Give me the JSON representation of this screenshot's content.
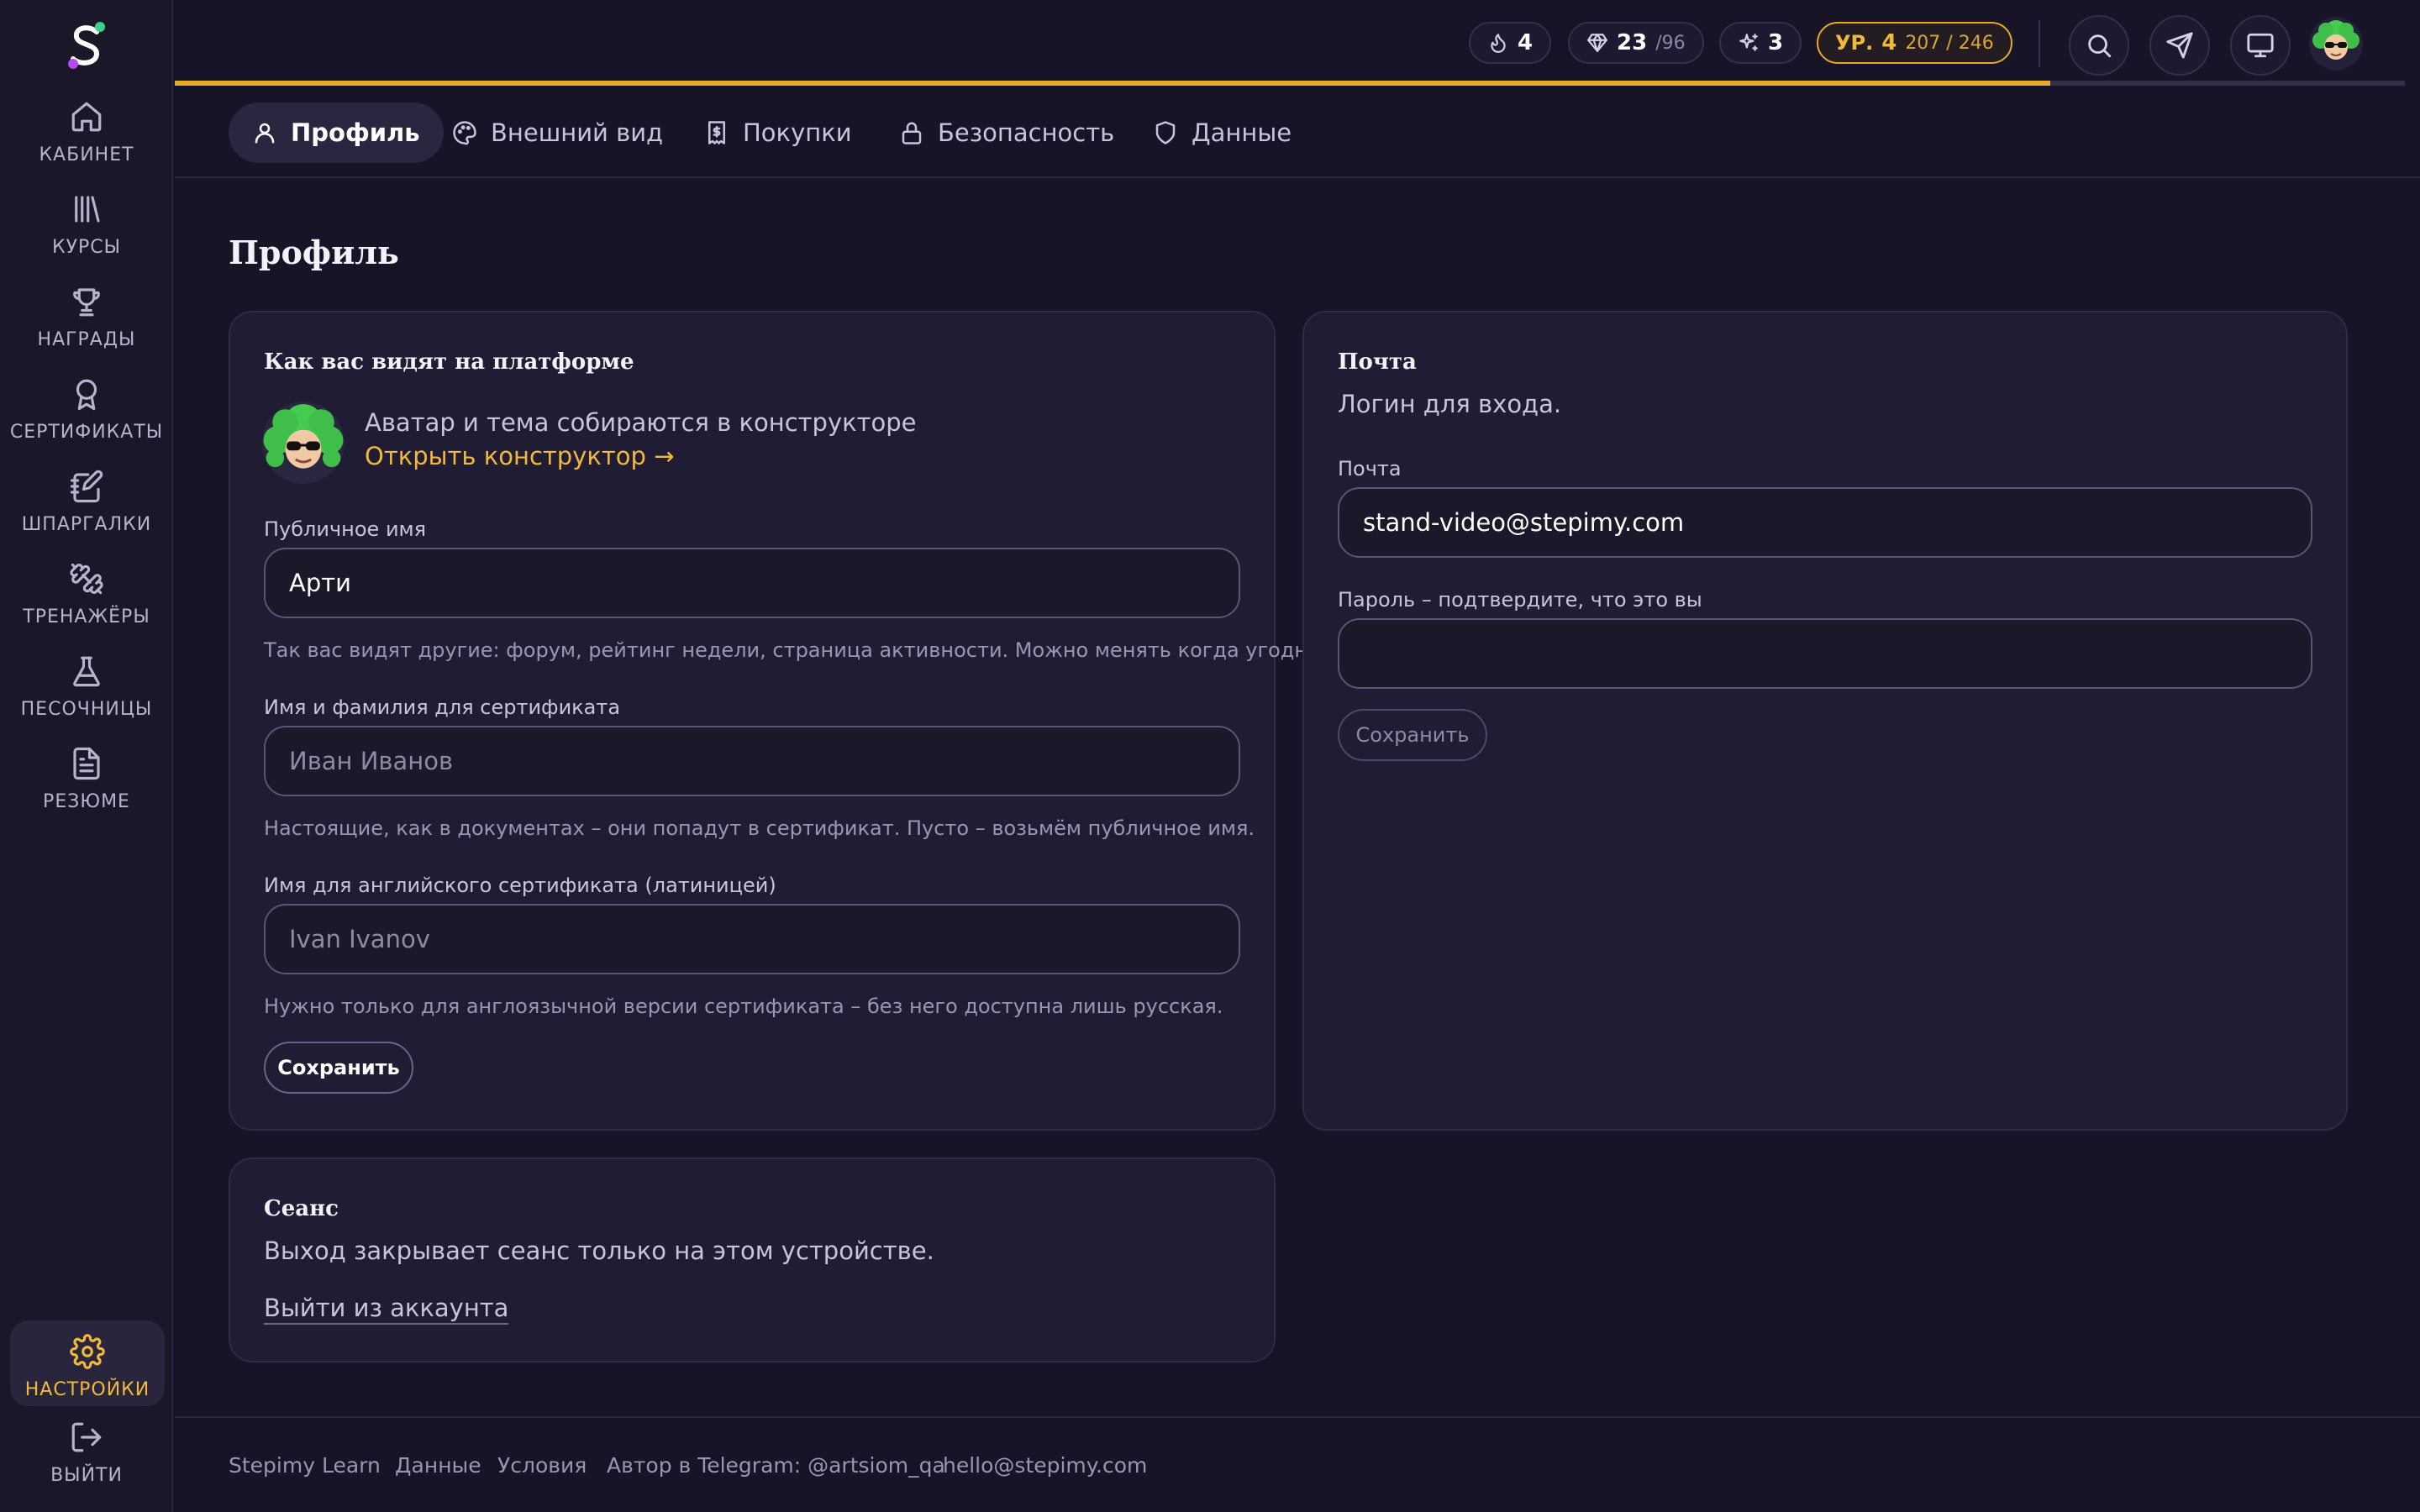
{
  "sidebar": {
    "items": [
      {
        "label": "КАБИНЕТ",
        "icon": "home-icon"
      },
      {
        "label": "КУРСЫ",
        "icon": "library-icon"
      },
      {
        "label": "НАГРАДЫ",
        "icon": "trophy-icon"
      },
      {
        "label": "СЕРТИФИКАТЫ",
        "icon": "award-icon"
      },
      {
        "label": "ШПАРГАЛКИ",
        "icon": "notebook-pen-icon"
      },
      {
        "label": "ТРЕНАЖЁРЫ",
        "icon": "dumbbell-icon"
      },
      {
        "label": "ПЕСОЧНИЦЫ",
        "icon": "flask-icon"
      },
      {
        "label": "РЕЗЮМЕ",
        "icon": "file-text-icon"
      }
    ],
    "settings_label": "НАСТРОЙКИ",
    "logout_label": "ВЫЙТИ"
  },
  "header": {
    "streak": "4",
    "gems": "23",
    "gems_total": "/96",
    "sparkles": "3",
    "level_prefix": "УР.",
    "level": "4",
    "xp": "207 / 246",
    "xp_progress": 0.8411
  },
  "tabs": [
    {
      "label": "Профиль",
      "icon": "user-icon",
      "active": true
    },
    {
      "label": "Внешний вид",
      "icon": "palette-icon"
    },
    {
      "label": "Покупки",
      "icon": "receipt-icon"
    },
    {
      "label": "Безопасность",
      "icon": "lock-icon"
    },
    {
      "label": "Данные",
      "icon": "shield-icon"
    }
  ],
  "page_title": "Профиль",
  "profile_card": {
    "title": "Как вас видят на платформе",
    "avatar_text": "Аватар и тема собираются в конструкторе",
    "constructor_link": "Открыть конструктор →",
    "public_name_label": "Публичное имя",
    "public_name_value": "Арти",
    "public_name_hint": "Так вас видят другие: форум, рейтинг недели, страница активности. Можно менять когда угодно.",
    "cert_name_label": "Имя и фамилия для сертификата",
    "cert_name_placeholder": "Иван Иванов",
    "cert_name_hint": "Настоящие, как в документах – они попадут в сертификат. Пусто – возьмём публичное имя.",
    "en_name_label": "Имя для английского сертификата (латиницей)",
    "en_name_placeholder": "Ivan Ivanov",
    "en_name_hint": "Нужно только для англоязычной версии сертификата – без него доступна лишь русская.",
    "save_label": "Сохранить"
  },
  "email_card": {
    "title": "Почта",
    "subtitle": "Логин для входа.",
    "email_label": "Почта",
    "email_value": "stand-video@stepimy.com",
    "password_label": "Пароль – подтвердите, что это вы",
    "password_value": "",
    "save_label": "Сохранить"
  },
  "session_card": {
    "title": "Сеанс",
    "text": "Выход закрывает сеанс только на этом устройстве.",
    "logout_link": "Выйти из аккаунта"
  },
  "footer": {
    "links": [
      "Stepimy Learn",
      "Данные",
      "Условия",
      "Автор в Telegram: @artsiom_qa",
      "hello@stepimy.com"
    ]
  },
  "colors": {
    "accent": "#f1b93c",
    "background": "#171427",
    "card": "#201c33"
  }
}
